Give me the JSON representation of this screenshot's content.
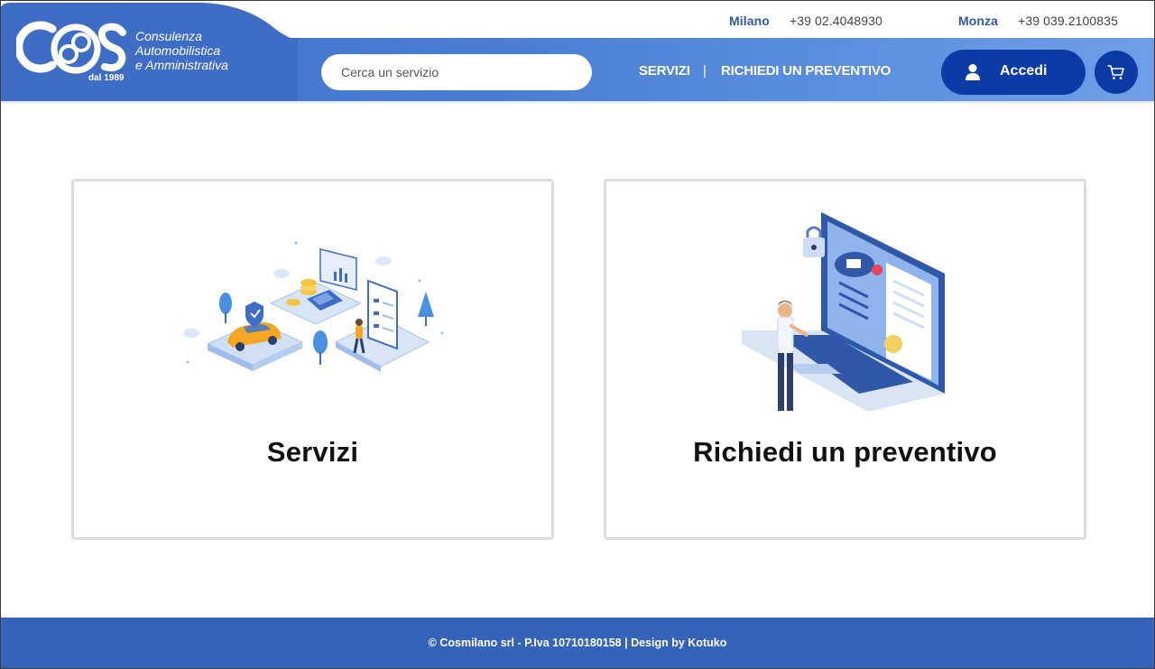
{
  "brand": {
    "logo_letters": "COS",
    "tagline_lines": [
      "Consulenza",
      "Automobilistica",
      "e Amministrativa"
    ],
    "since": "dal 1989"
  },
  "contacts": [
    {
      "city": "Milano",
      "phone": "+39 02.4048930"
    },
    {
      "city": "Monza",
      "phone": "+39 039.2100835"
    }
  ],
  "search": {
    "placeholder": "Cerca un servizio",
    "value": ""
  },
  "nav": {
    "servizi": "SERVIZI",
    "separator": "|",
    "preventivo": "RICHIEDI UN PREVENTIVO"
  },
  "actions": {
    "login_label": "Accedi",
    "user_icon": "user-icon",
    "cart_icon": "cart-icon"
  },
  "cards": [
    {
      "title": "Servizi",
      "illustration": "car-services-illustration"
    },
    {
      "title": "Richiedi un preventivo",
      "illustration": "laptop-quote-illustration"
    }
  ],
  "footer": {
    "text": "© Cosmilano srl - P.Iva 10710180158 | Design by Kotuko"
  },
  "colors": {
    "header_blue": "#4a7fd4",
    "button_blue": "#0d3ba6",
    "footer_blue": "#3563ba",
    "city_blue": "#2f58a8",
    "card_border": "#dcdcdc"
  }
}
